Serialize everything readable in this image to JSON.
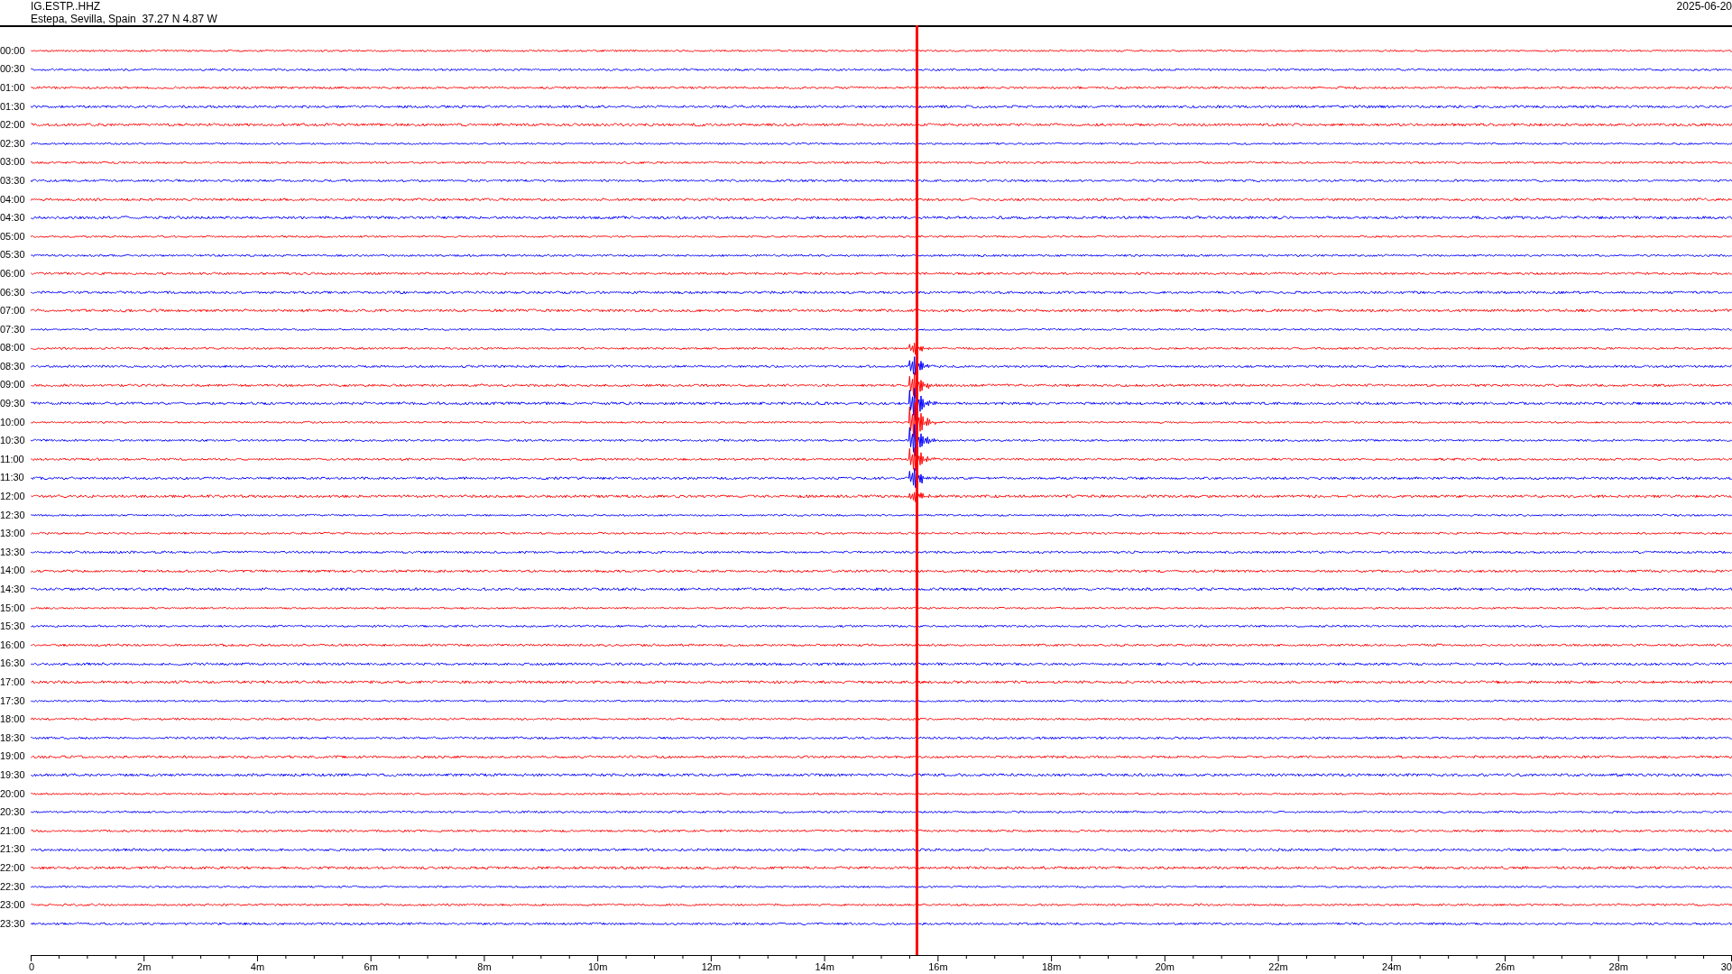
{
  "header": {
    "channel": "IG.ESTP..HHZ",
    "location": "Estepa, Sevilla, Spain  37.27 N 4.87 W",
    "date": "2025-06-20"
  },
  "rows": [
    {
      "label": "00:00",
      "color": "#ff0000"
    },
    {
      "label": "00:30",
      "color": "#0000ff"
    },
    {
      "label": "01:00",
      "color": "#ff0000"
    },
    {
      "label": "01:30",
      "color": "#0000ff"
    },
    {
      "label": "02:00",
      "color": "#ff0000"
    },
    {
      "label": "02:30",
      "color": "#0000ff"
    },
    {
      "label": "03:00",
      "color": "#ff0000"
    },
    {
      "label": "03:30",
      "color": "#0000ff"
    },
    {
      "label": "04:00",
      "color": "#ff0000"
    },
    {
      "label": "04:30",
      "color": "#0000ff"
    },
    {
      "label": "05:00",
      "color": "#ff0000"
    },
    {
      "label": "05:30",
      "color": "#0000ff"
    },
    {
      "label": "06:00",
      "color": "#ff0000"
    },
    {
      "label": "06:30",
      "color": "#0000ff"
    },
    {
      "label": "07:00",
      "color": "#ff0000"
    },
    {
      "label": "07:30",
      "color": "#0000ff"
    },
    {
      "label": "08:00",
      "color": "#ff0000"
    },
    {
      "label": "08:30",
      "color": "#0000ff"
    },
    {
      "label": "09:00",
      "color": "#ff0000"
    },
    {
      "label": "09:30",
      "color": "#0000ff"
    },
    {
      "label": "10:00",
      "color": "#ff0000"
    },
    {
      "label": "10:30",
      "color": "#0000ff"
    },
    {
      "label": "11:00",
      "color": "#ff0000"
    },
    {
      "label": "11:30",
      "color": "#0000ff"
    },
    {
      "label": "12:00",
      "color": "#ff0000"
    },
    {
      "label": "12:30",
      "color": "#0000ff"
    },
    {
      "label": "13:00",
      "color": "#ff0000"
    },
    {
      "label": "13:30",
      "color": "#0000ff"
    },
    {
      "label": "14:00",
      "color": "#ff0000"
    },
    {
      "label": "14:30",
      "color": "#0000ff"
    },
    {
      "label": "15:00",
      "color": "#ff0000"
    },
    {
      "label": "15:30",
      "color": "#0000ff"
    },
    {
      "label": "16:00",
      "color": "#ff0000"
    },
    {
      "label": "16:30",
      "color": "#0000ff"
    },
    {
      "label": "17:00",
      "color": "#ff0000"
    },
    {
      "label": "17:30",
      "color": "#0000ff"
    },
    {
      "label": "18:00",
      "color": "#ff0000"
    },
    {
      "label": "18:30",
      "color": "#0000ff"
    },
    {
      "label": "19:00",
      "color": "#ff0000"
    },
    {
      "label": "19:30",
      "color": "#0000ff"
    },
    {
      "label": "20:00",
      "color": "#ff0000"
    },
    {
      "label": "20:30",
      "color": "#0000ff"
    },
    {
      "label": "21:00",
      "color": "#ff0000"
    },
    {
      "label": "21:30",
      "color": "#0000ff"
    },
    {
      "label": "22:00",
      "color": "#ff0000"
    },
    {
      "label": "22:30",
      "color": "#0000ff"
    },
    {
      "label": "23:00",
      "color": "#ff0000"
    },
    {
      "label": "23:30",
      "color": "#0000ff"
    }
  ],
  "x_axis": {
    "labels": [
      "0",
      "2m",
      "4m",
      "6m",
      "8m",
      "10m",
      "12m",
      "14m",
      "16m",
      "18m",
      "20m",
      "22m",
      "24m",
      "26m",
      "28m",
      "30"
    ]
  }
}
